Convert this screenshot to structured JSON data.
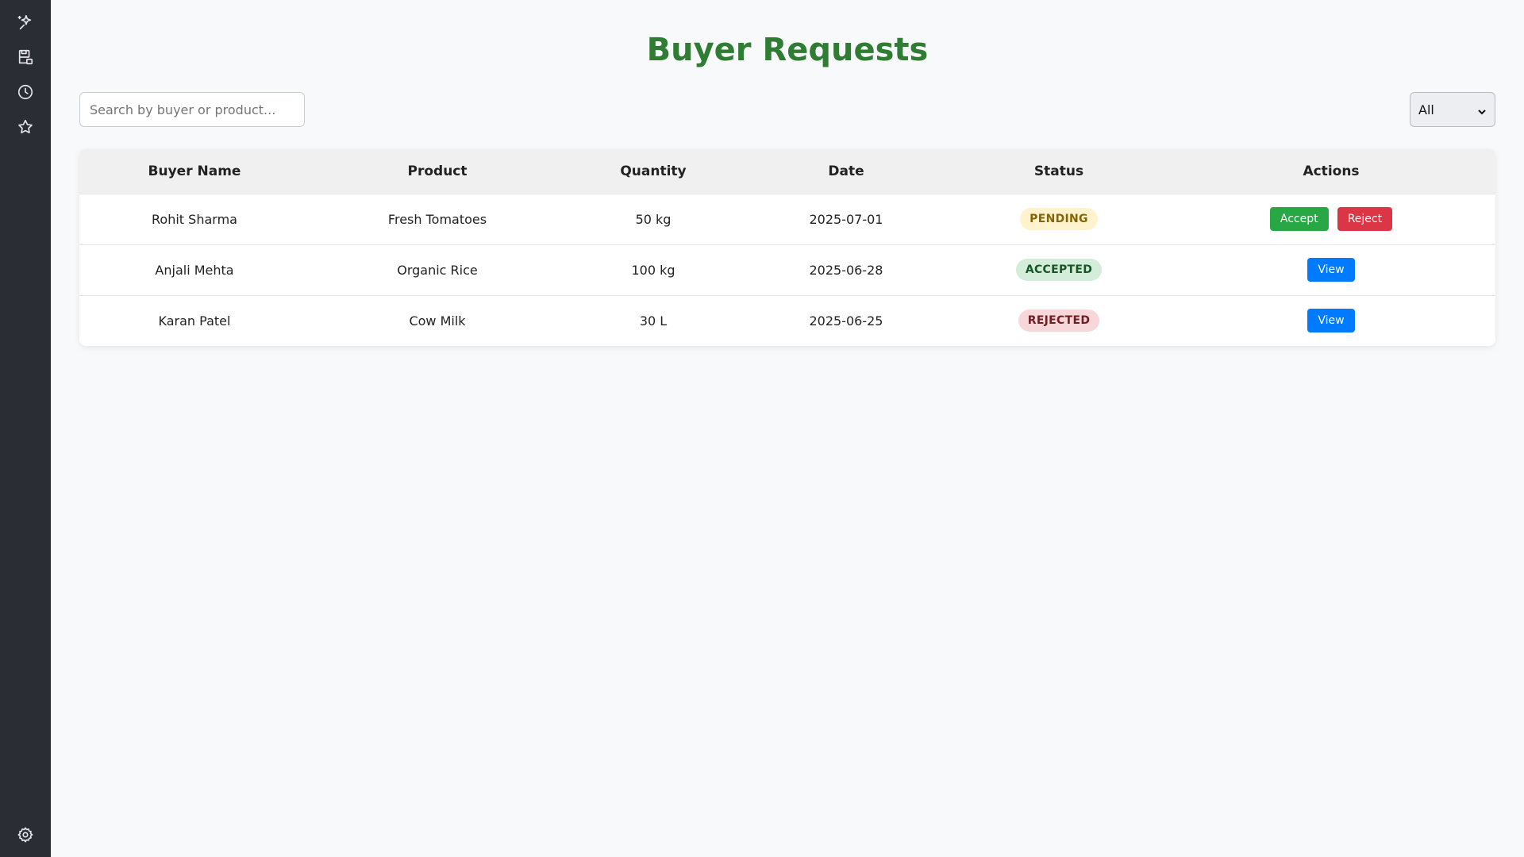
{
  "sidebar": {
    "icons": [
      "sparkle-icon",
      "database-save-icon",
      "clock-icon",
      "star-icon",
      "gear-icon"
    ]
  },
  "page": {
    "title": "Buyer Requests"
  },
  "search": {
    "placeholder": "Search by buyer or product..."
  },
  "filter": {
    "selected": "All"
  },
  "table": {
    "headers": {
      "buyer": "Buyer Name",
      "product": "Product",
      "quantity": "Quantity",
      "date": "Date",
      "status": "Status",
      "actions": "Actions"
    },
    "rows": [
      {
        "buyer": "Rohit Sharma",
        "product": "Fresh Tomatoes",
        "quantity": "50 kg",
        "date": "2025-07-01",
        "status": "PENDING",
        "actions": [
          "Accept",
          "Reject"
        ]
      },
      {
        "buyer": "Anjali Mehta",
        "product": "Organic Rice",
        "quantity": "100 kg",
        "date": "2025-06-28",
        "status": "ACCEPTED",
        "actions": [
          "View"
        ]
      },
      {
        "buyer": "Karan Patel",
        "product": "Cow Milk",
        "quantity": "30 L",
        "date": "2025-06-25",
        "status": "REJECTED",
        "actions": [
          "View"
        ]
      }
    ]
  },
  "colors": {
    "title": "#2e7d32",
    "sidebar": "#2b2d34",
    "accept": "#28a745",
    "reject": "#dc3545",
    "view": "#007bff"
  }
}
